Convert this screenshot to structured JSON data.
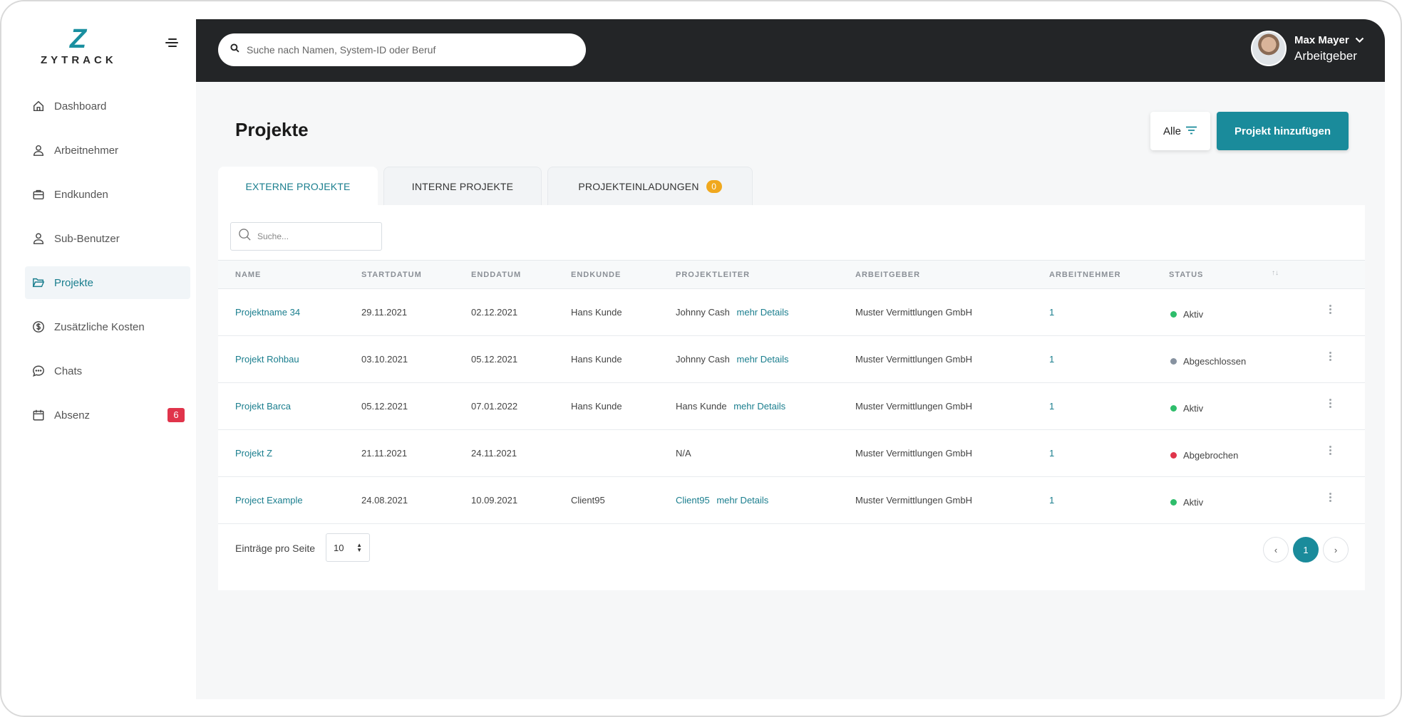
{
  "app": {
    "logo_mark": "Z",
    "logo_word": "ZYTRACK"
  },
  "sidebar": {
    "items": [
      {
        "label": "Dashboard",
        "icon": "home-icon"
      },
      {
        "label": "Arbeitnehmer",
        "icon": "user-icon"
      },
      {
        "label": "Endkunden",
        "icon": "briefcase-icon"
      },
      {
        "label": "Sub-Benutzer",
        "icon": "user-outline-icon"
      },
      {
        "label": "Projekte",
        "icon": "folder-open-icon",
        "active": true
      },
      {
        "label": "Zusätzliche Kosten",
        "icon": "dollar-circle-icon"
      },
      {
        "label": "Chats",
        "icon": "chat-bubble-icon"
      },
      {
        "label": "Absenz",
        "icon": "calendar-icon",
        "badge": "6"
      }
    ]
  },
  "header": {
    "search_placeholder": "Suche nach Namen, System-ID oder Beruf",
    "user": {
      "name": "Max Mayer",
      "role": "Arbeitgeber"
    }
  },
  "page": {
    "title": "Projekte",
    "filter_label": "Alle",
    "add_button": "Projekt hinzufügen"
  },
  "tabs": [
    {
      "label": "EXTERNE PROJEKTE",
      "active": true
    },
    {
      "label": "INTERNE PROJEKTE"
    },
    {
      "label": "PROJEKTEINLADUNGEN",
      "badge": "0"
    }
  ],
  "table": {
    "search_placeholder": "Suche...",
    "columns": [
      "NAME",
      "STARTDATUM",
      "ENDDATUM",
      "ENDKUNDE",
      "PROJEKTLEITER",
      "ARBEITGEBER",
      "ARBEITNEHMER",
      "STATUS"
    ],
    "sort_icon": "↑↓",
    "more_label": "mehr Details",
    "rows": [
      {
        "name": "Projektname 34",
        "start": "29.11.2021",
        "end": "02.12.2021",
        "client": "Hans Kunde",
        "leader": "Johnny Cash",
        "more": true,
        "employer": "Muster Vermittlungen GmbH",
        "employees": "1",
        "status": "Aktiv",
        "status_color": "#2ebd6b"
      },
      {
        "name": "Projekt Rohbau",
        "start": "03.10.2021",
        "end": "05.12.2021",
        "client": "Hans Kunde",
        "leader": "Johnny Cash",
        "more": true,
        "employer": "Muster Vermittlungen GmbH",
        "employees": "1",
        "status": "Abgeschlossen",
        "status_color": "#8792a0"
      },
      {
        "name": "Projekt Barca",
        "start": "05.12.2021",
        "end": "07.01.2022",
        "client": "Hans Kunde",
        "leader": "Hans Kunde",
        "more": true,
        "employer": "Muster Vermittlungen GmbH",
        "employees": "1",
        "status": "Aktiv",
        "status_color": "#2ebd6b"
      },
      {
        "name": "Projekt Z",
        "start": "21.11.2021",
        "end": "24.11.2021",
        "client": "",
        "leader": "N/A",
        "more": false,
        "employer": "Muster Vermittlungen GmbH",
        "employees": "1",
        "status": "Abgebrochen",
        "status_color": "#e0344b"
      },
      {
        "name": "Project Example",
        "start": "24.08.2021",
        "end": "10.09.2021",
        "client": "Client95",
        "leader": "Client95",
        "more": true,
        "employer": "Muster Vermittlungen GmbH",
        "employees": "1",
        "status": "Aktiv",
        "status_color": "#2ebd6b"
      }
    ]
  },
  "pagination": {
    "per_page_label": "Einträge pro Seite",
    "per_page_value": "10",
    "current_page": "1",
    "prev_icon": "‹",
    "next_icon": "›"
  },
  "colors": {
    "accent": "#1a8b9b",
    "topbar": "#232527",
    "badge_red": "#e0344b",
    "badge_orange": "#f0a81e"
  }
}
